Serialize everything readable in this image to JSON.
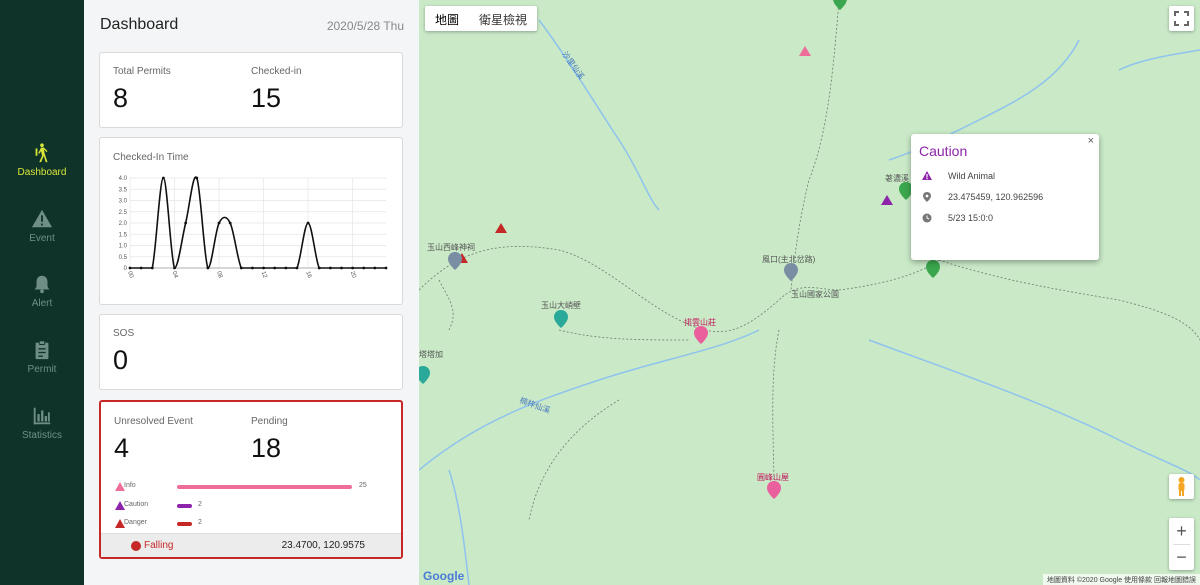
{
  "sidebar": {
    "items": [
      {
        "label": "Dashboard",
        "icon": "hiker-icon",
        "active": true
      },
      {
        "label": "Event",
        "icon": "warning-icon"
      },
      {
        "label": "Alert",
        "icon": "bell-icon"
      },
      {
        "label": "Permit",
        "icon": "clipboard-icon"
      },
      {
        "label": "Statistics",
        "icon": "bar-chart-icon"
      }
    ]
  },
  "panel": {
    "title": "Dashboard",
    "date": "2020/5/28 Thu",
    "permits": {
      "total_label": "Total Permits",
      "total_value": "8",
      "checked_label": "Checked-in",
      "checked_value": "15"
    },
    "checkin_chart": {
      "title": "Checked-In Time"
    },
    "sos": {
      "label": "SOS",
      "value": "0"
    },
    "events": {
      "unresolved_label": "Unresolved Event",
      "unresolved_value": "4",
      "pending_label": "Pending",
      "pending_value": "18",
      "rows": [
        {
          "label": "Info",
          "count": "25",
          "color": "#ef6d9b"
        },
        {
          "label": "Caution",
          "count": "2",
          "color": "#8e24aa"
        },
        {
          "label": "Danger",
          "count": "2",
          "color": "#c62828"
        }
      ],
      "footer_status": "Falling",
      "footer_coords": "23.4700, 120.9575"
    }
  },
  "chart_data": {
    "type": "line",
    "title": "Checked-In Time",
    "x": [
      "00",
      "01",
      "02",
      "03",
      "04",
      "05",
      "06",
      "07",
      "08",
      "09",
      "10",
      "11",
      "12",
      "13",
      "14",
      "15",
      "16",
      "17",
      "18",
      "19",
      "20",
      "21",
      "22",
      "23"
    ],
    "values": [
      0,
      0,
      0,
      4,
      0,
      2,
      4,
      0,
      2,
      2,
      0,
      0,
      0,
      0,
      0,
      0,
      2,
      0,
      0,
      0,
      0,
      0,
      0,
      0
    ],
    "x_tick_labels": [
      "00",
      "04",
      "08",
      "12",
      "16",
      "20"
    ],
    "y_tick_labels": [
      "0",
      "0.5",
      "1.0",
      "1.5",
      "2.0",
      "2.5",
      "3.0",
      "3.5",
      "4.0"
    ],
    "ylim": [
      0,
      4
    ],
    "grid": true
  },
  "map": {
    "map_type": {
      "map_label": "地圖",
      "satellite_label": "衛星檢視"
    },
    "labels": [
      {
        "text": "玉山西峰神祠"
      },
      {
        "text": "玉山大峭壁"
      },
      {
        "text": "排雲山莊"
      },
      {
        "text": "塔塔加"
      },
      {
        "text": "玉山國家公園"
      },
      {
        "text": "風口(主北岔路)"
      },
      {
        "text": "荖濃溪"
      },
      {
        "text": "圓峰山屋"
      },
      {
        "text": "沙里仙溪"
      },
      {
        "text": "楠梓仙溪"
      }
    ],
    "google_label": "Google",
    "attribution": "地圖資料 ©2020 Google   使用條款   回報地圖錯誤",
    "zoom_in": "+",
    "zoom_out": "−"
  },
  "infowindow": {
    "title": "Caution",
    "type": "Wild Animal",
    "coords": "23.475459, 120.962596",
    "time": "5/23 15:0:0",
    "close": "×",
    "title_color": "#8e24aa"
  }
}
